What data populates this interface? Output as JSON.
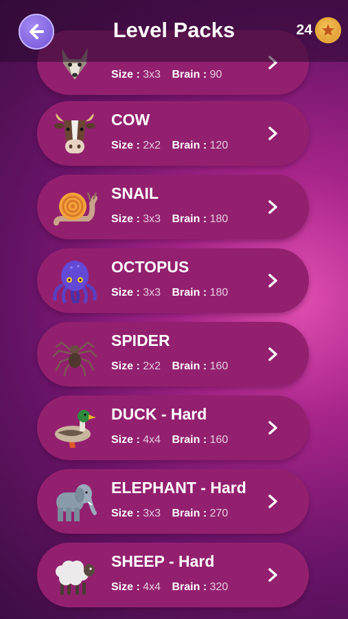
{
  "header": {
    "title": "Level Packs",
    "coins": "24"
  },
  "labels": {
    "size": "Size :",
    "brain": "Brain :"
  },
  "packs": [
    {
      "name": "",
      "size": "3x3",
      "brain": "90"
    },
    {
      "name": "COW",
      "size": "2x2",
      "brain": "120"
    },
    {
      "name": "SNAIL",
      "size": "3x3",
      "brain": "180"
    },
    {
      "name": "OCTOPUS",
      "size": "3x3",
      "brain": "180"
    },
    {
      "name": "SPIDER",
      "size": "2x2",
      "brain": "160"
    },
    {
      "name": "DUCK - Hard",
      "size": "4x4",
      "brain": "160"
    },
    {
      "name": "ELEPHANT - Hard",
      "size": "3x3",
      "brain": "270"
    },
    {
      "name": "SHEEP - Hard",
      "size": "4x4",
      "brain": "320"
    }
  ]
}
